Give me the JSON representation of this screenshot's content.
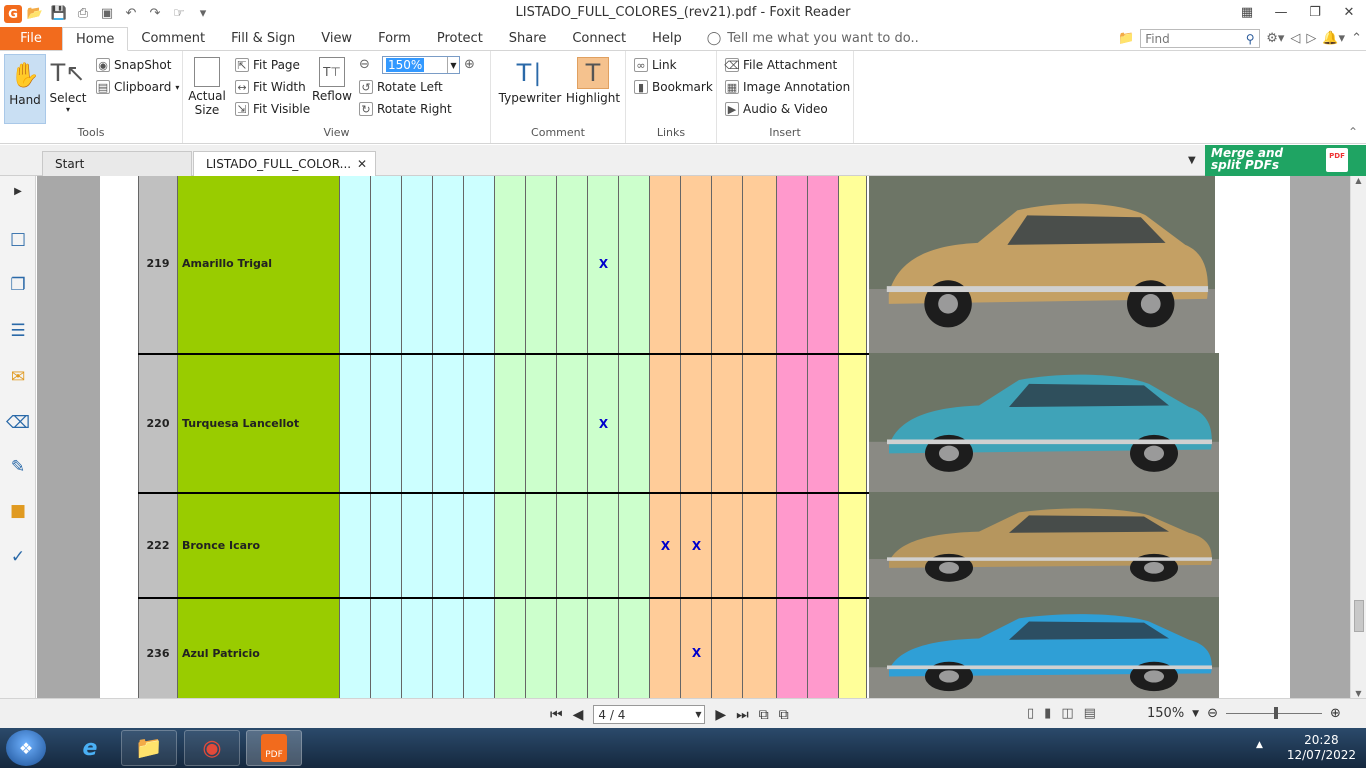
{
  "window": {
    "title": "LISTADO_FULL_COLORES_(rev21).pdf - Foxit Reader"
  },
  "ribbon_tabs": {
    "file": "File",
    "items": [
      "Home",
      "Comment",
      "Fill & Sign",
      "View",
      "Form",
      "Protect",
      "Share",
      "Connect",
      "Help"
    ],
    "tell_me": "Tell me what you want to do.."
  },
  "find": {
    "placeholder": "Find"
  },
  "ribbon": {
    "tools": {
      "hand": "Hand",
      "select": "Select",
      "snapshot": "SnapShot",
      "clipboard": "Clipboard",
      "label": "Tools"
    },
    "view": {
      "actual_size_1": "Actual",
      "actual_size_2": "Size",
      "fit_page": "Fit Page",
      "fit_width": "Fit Width",
      "fit_visible": "Fit Visible",
      "reflow": "Reflow",
      "zoom_value": "150%",
      "rotate_left": "Rotate Left",
      "rotate_right": "Rotate Right",
      "label": "View"
    },
    "comment": {
      "typewriter": "Typewriter",
      "highlight": "Highlight",
      "label": "Comment"
    },
    "links": {
      "link": "Link",
      "bookmark": "Bookmark",
      "label": "Links"
    },
    "insert": {
      "file_attachment": "File Attachment",
      "image_annotation": "Image Annotation",
      "audio_video": "Audio & Video",
      "label": "Insert"
    }
  },
  "doc_tabs": {
    "start": "Start",
    "current": "LISTADO_FULL_COLOR..."
  },
  "promo": {
    "line1": "Merge and",
    "line2": "split PDFs",
    "badge": "PDF"
  },
  "table": {
    "rows": [
      {
        "number": "219",
        "name": "Amarillo Trigal",
        "marks": [
          8
        ]
      },
      {
        "number": "220",
        "name": "Turquesa Lancellot",
        "marks": [
          8
        ]
      },
      {
        "number": "222",
        "name": "Bronce Icaro",
        "marks": [
          10,
          11
        ]
      },
      {
        "number": "236",
        "name": "Azul Patricio",
        "marks": [
          11
        ]
      }
    ],
    "mark_symbol": "X",
    "column_colors": [
      "#ccffff",
      "#ccffff",
      "#ccffff",
      "#ccffff",
      "#ccffff",
      "#ccffcc",
      "#ccffcc",
      "#ccffcc",
      "#ccffcc",
      "#ccffcc",
      "#ffcc99",
      "#ffcc99",
      "#ffcc99",
      "#ffcc99",
      "#ff99cc",
      "#ff99cc",
      "#ffff99"
    ],
    "photo_colors": [
      "#c4a064",
      "#3fa3b8",
      "#b6965e",
      "#2f9fd6"
    ]
  },
  "statusbar": {
    "page_value": "4 / 4",
    "zoom": "150%"
  },
  "taskbar": {
    "time": "20:28",
    "date": "12/07/2022",
    "foxit_badge": "PDF"
  }
}
